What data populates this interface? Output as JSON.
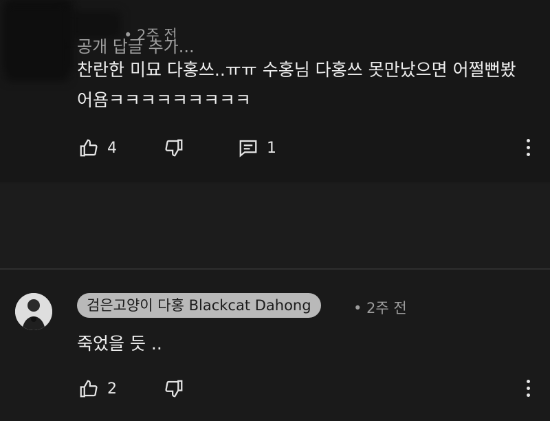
{
  "comment1": {
    "meta": "• 2주 전",
    "text": "찬란한 미묘 다홍쓰..ㅠㅠ 수홍님 다홍쓰 못만났으면 어쩔뻔봤어욤ㅋㅋㅋㅋㅋㅋㅋㅋㅋ",
    "likes": "4",
    "replies": "1"
  },
  "reply_input": {
    "placeholder": "공개 답글 추가..."
  },
  "comment2": {
    "author": "검은고양이 다홍 Blackcat Dahong",
    "meta": "• 2주 전",
    "text": "죽었을 듯 ..",
    "likes": "2"
  },
  "icons": {
    "like": "thumbs-up-icon",
    "dislike": "thumbs-down-icon",
    "reply": "comment-icon",
    "more": "more-vertical-icon"
  },
  "colors": {
    "background": "#1b1b1b",
    "text": "#efefef",
    "secondary": "#9d9d9d",
    "author_pill": "#b9b9b9"
  }
}
